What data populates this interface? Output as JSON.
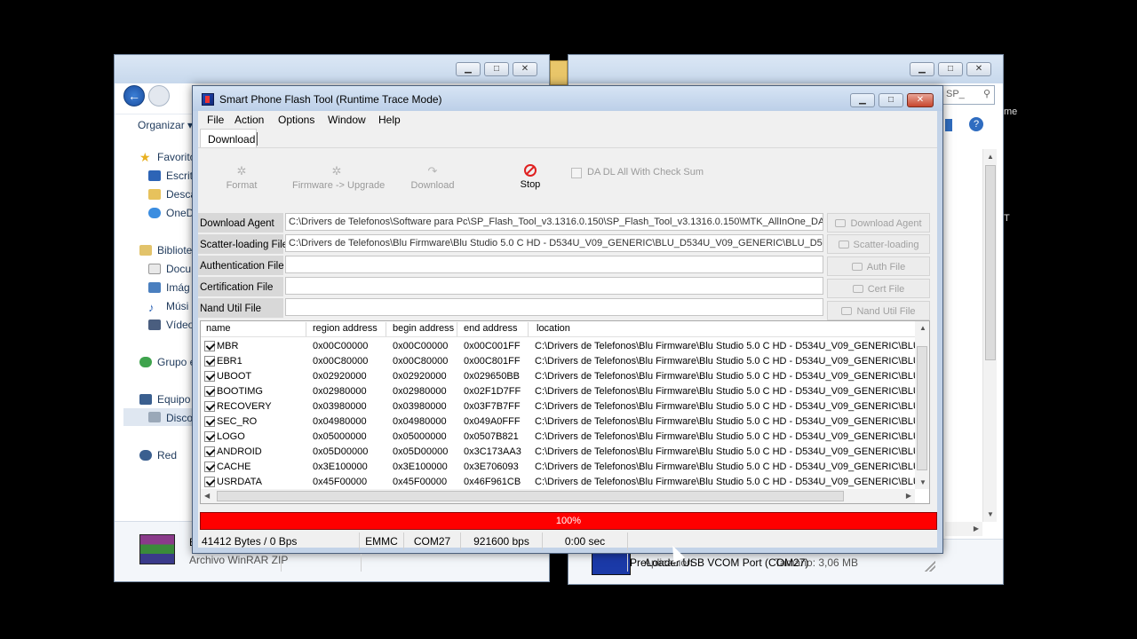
{
  "flash_tool": {
    "title": "Smart Phone Flash Tool (Runtime Trace Mode)",
    "menu": [
      "File",
      "Action",
      "Options",
      "Window",
      "Help"
    ],
    "tab": "Download",
    "toolbar": {
      "format": "Format",
      "firmware_upgrade": "Firmware -> Upgrade",
      "download": "Download",
      "stop": "Stop",
      "da_dl_all": "DA DL All With Check Sum"
    },
    "fields": [
      {
        "label": "Download Agent",
        "value": "C:\\Drivers de Telefonos\\Software para Pc\\SP_Flash_Tool_v3.1316.0.150\\SP_Flash_Tool_v3.1316.0.150\\MTK_AllInOne_DA.",
        "button": "Download Agent"
      },
      {
        "label": "Scatter-loading File",
        "value": "C:\\Drivers de Telefonos\\Blu Firmware\\Blu Studio 5.0 C HD - D534U_V09_GENERIC\\BLU_D534U_V09_GENERIC\\BLU_D534",
        "button": "Scatter-loading"
      },
      {
        "label": "Authentication File",
        "value": "",
        "button": "Auth File"
      },
      {
        "label": "Certification File",
        "value": "",
        "button": "Cert File"
      },
      {
        "label": "Nand Util File",
        "value": "",
        "button": "Nand Util File"
      }
    ],
    "table": {
      "columns": [
        "name",
        "region address",
        "begin address",
        "end address",
        "location"
      ],
      "rows": [
        {
          "name": "MBR",
          "region": "0x00C00000",
          "begin": "0x00C00000",
          "end": "0x00C001FF",
          "location": "C:\\Drivers de Telefonos\\Blu Firmware\\Blu Studio 5.0 C HD - D534U_V09_GENERIC\\BLU_"
        },
        {
          "name": "EBR1",
          "region": "0x00C80000",
          "begin": "0x00C80000",
          "end": "0x00C801FF",
          "location": "C:\\Drivers de Telefonos\\Blu Firmware\\Blu Studio 5.0 C HD - D534U_V09_GENERIC\\BLU_"
        },
        {
          "name": "UBOOT",
          "region": "0x02920000",
          "begin": "0x02920000",
          "end": "0x029650BB",
          "location": "C:\\Drivers de Telefonos\\Blu Firmware\\Blu Studio 5.0 C HD - D534U_V09_GENERIC\\BLU_"
        },
        {
          "name": "BOOTIMG",
          "region": "0x02980000",
          "begin": "0x02980000",
          "end": "0x02F1D7FF",
          "location": "C:\\Drivers de Telefonos\\Blu Firmware\\Blu Studio 5.0 C HD - D534U_V09_GENERIC\\BLU_"
        },
        {
          "name": "RECOVERY",
          "region": "0x03980000",
          "begin": "0x03980000",
          "end": "0x03F7B7FF",
          "location": "C:\\Drivers de Telefonos\\Blu Firmware\\Blu Studio 5.0 C HD - D534U_V09_GENERIC\\BLU_"
        },
        {
          "name": "SEC_RO",
          "region": "0x04980000",
          "begin": "0x04980000",
          "end": "0x049A0FFF",
          "location": "C:\\Drivers de Telefonos\\Blu Firmware\\Blu Studio 5.0 C HD - D534U_V09_GENERIC\\BLU_"
        },
        {
          "name": "LOGO",
          "region": "0x05000000",
          "begin": "0x05000000",
          "end": "0x0507B821",
          "location": "C:\\Drivers de Telefonos\\Blu Firmware\\Blu Studio 5.0 C HD - D534U_V09_GENERIC\\BLU_"
        },
        {
          "name": "ANDROID",
          "region": "0x05D00000",
          "begin": "0x05D00000",
          "end": "0x3C173AA3",
          "location": "C:\\Drivers de Telefonos\\Blu Firmware\\Blu Studio 5.0 C HD - D534U_V09_GENERIC\\BLU_"
        },
        {
          "name": "CACHE",
          "region": "0x3E100000",
          "begin": "0x3E100000",
          "end": "0x3E706093",
          "location": "C:\\Drivers de Telefonos\\Blu Firmware\\Blu Studio 5.0 C HD - D534U_V09_GENERIC\\BLU_"
        },
        {
          "name": "USRDATA",
          "region": "0x45F00000",
          "begin": "0x45F00000",
          "end": "0x46F961CB",
          "location": "C:\\Drivers de Telefonos\\Blu Firmware\\Blu Studio 5.0 C HD - D534U_V09_GENERIC\\BLU_"
        }
      ]
    },
    "progress": {
      "label": "100%",
      "fraction": 1.0,
      "color": "#ff0000"
    },
    "status": {
      "transfer": "41412 Bytes / 0 Bps",
      "storage": "EMMC",
      "port": "COM27",
      "baud": "921600 bps",
      "time": "0:00 sec",
      "device": "PreLoader USB VCOM Port (COM27)"
    }
  },
  "left_explorer": {
    "organize": "Organizar",
    "favorites": "Favorito",
    "items": [
      "Escrit",
      "Desca",
      "OneD"
    ],
    "libraries": "Bibliote",
    "lib_items": [
      "Docu",
      "Imág",
      "Músi",
      "Vídeo"
    ],
    "homegroup": "Grupo e",
    "computer": "Equipo",
    "disk": "Disco",
    "network": "Red",
    "file_type": "Archivo WinRAR ZIP",
    "file_initial": "E"
  },
  "right_explorer": {
    "search_fragment": "SP_",
    "file_type": "Aplicación",
    "size": "Tamaño: 3,06 MB"
  },
  "background_text": {
    "fragment_1": "me",
    "fragment_2": "T"
  }
}
